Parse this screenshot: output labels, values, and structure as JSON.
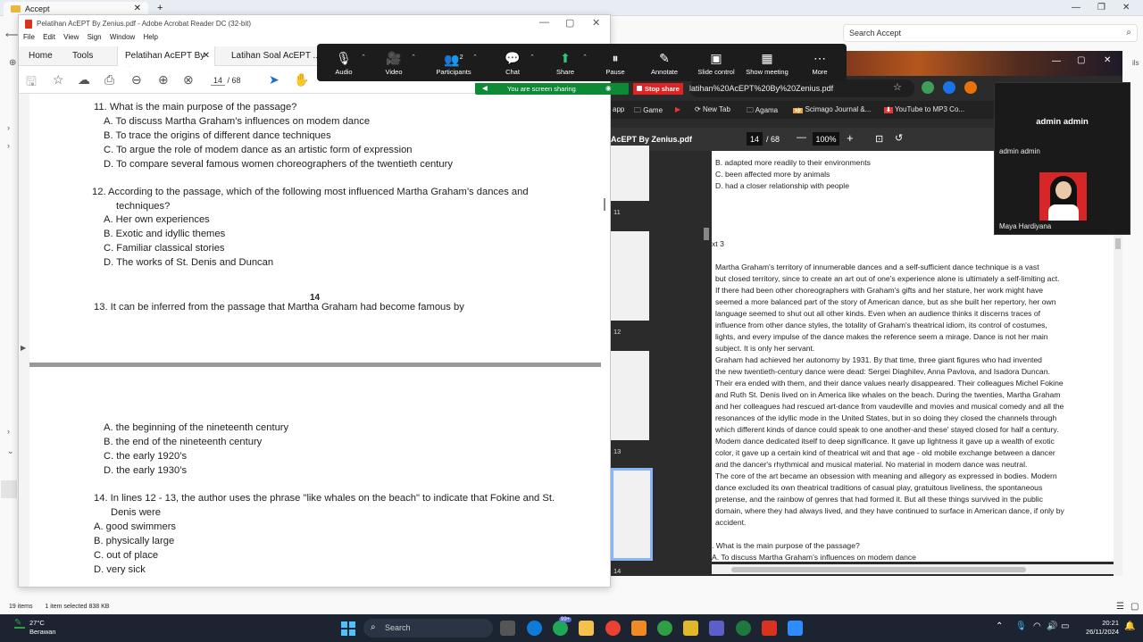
{
  "explorer": {
    "tab_title": "Accept",
    "search_placeholder": "Search Accept",
    "status_items": "19 items",
    "status_selected": "1 item selected  838 KB",
    "side_text": "ils"
  },
  "acrobat": {
    "window_title": "Pelatihan AcEPT By Zenius.pdf - Adobe Acrobat Reader DC (32-bit)",
    "menu": [
      "File",
      "Edit",
      "View",
      "Sign",
      "Window",
      "Help"
    ],
    "tabs": [
      "Home",
      "Tools",
      "Pelatihan AcEPT By ...",
      "Latihan Soal AcEPT ..."
    ],
    "page_current": "14",
    "page_total": "/ 68",
    "content": {
      "q11": "11. What is the main purpose of the passage?",
      "q11_a": "A. To discuss Martha Graham’s influences on modem dance",
      "q11_b": "B. To trace the origins of different dance techniques",
      "q11_c": "C. To argue the role of modem dance as an artistic form of expression",
      "q11_d": "D. To compare several famous women choreographers of the twentieth century",
      "q12_line1": "12.  According to the passage, which of the following most influenced Martha Graham’s dances and",
      "q12_line2": "techniques?",
      "q12_a": "A. Her own experiences",
      "q12_b": "B. Exotic and idyllic themes",
      "q12_c": "C. Familiar classical stories",
      "q12_d": "D. The works of St. Denis and Duncan",
      "page_number": "14",
      "q13": "13.  It can be inferred from the passage that Martha Graham had become famous by",
      "q13_a": "A. the beginning of the nineteenth century",
      "q13_b": "B. the end of the nineteenth century",
      "q13_c": "C. the early 1920’s",
      "q13_d": "D. the early 1930’s",
      "q14_line1": "14.  In lines 12 - 13, the author uses the phrase \"like whales on the beach\" to indicate that Fokine and St.",
      "q14_line2": "Denis were",
      "q14_a": "A.  good swimmers",
      "q14_b": "B.  physically large",
      "q14_c": "C.  out of place",
      "q14_d": "D.  very sick"
    }
  },
  "zoom": {
    "buttons": [
      "Audio",
      "Video",
      "Participants",
      "Chat",
      "Share",
      "Pause",
      "Annotate",
      "Slide control",
      "Show meeting",
      "More"
    ],
    "participants_count": "2",
    "sharing_text": "You are screen sharing",
    "stop_share": "Stop share",
    "panel_name_big": "admin admin",
    "panel_name_small": "admin admin",
    "camera_name": "Maya Hardiyana"
  },
  "chrome": {
    "address": "latihan%20AcEPT%20By%20Zenius.pdf",
    "bookmarks": [
      "app",
      "Game",
      "New Tab",
      "Agama",
      "Scimago Journal &...",
      "YouTube to MP3 Co..."
    ],
    "pdf_title": "AcEPT By Zenius.pdf",
    "pdf_page": "14",
    "pdf_total": "/ 68",
    "pdf_zoom": "100%",
    "thumb_numbers": [
      "11",
      "12",
      "13",
      "14"
    ],
    "page_lines": [
      "B. adapted more readily to their environments",
      "C. been affected more by animals",
      "D. had a closer relationship with people"
    ],
    "text_heading": "xt 3",
    "passage": [
      "        Martha Graham's territory of innumerable dances and a self-sufficient dance technique  is a vast",
      "but closed territory, since to create an art out of one's experience alone is ultimately a self-limiting act.",
      "If there had been other choreographers with Graham's gifts and her stature, her work might have",
      "seemed a more balanced part of the story of American dance, but as she built her repertory, her own",
      "language seemed to shut out all other kinds. Even when an audience thinks it discerns traces of",
      "influence from other dance styles, the totality of Graham's theatrical idiom, its control of costumes,",
      "lights, and every impulse of the dance makes the reference seem a mirage. Dance is not her main",
      "subject. It is only her servant.",
      "       Graham had achieved her autonomy by 1931. By that time, three giant figures who had invented",
      "the new twentieth-century dance were dead: Sergei Diaghilev, Anna Pavlova, and Isadora Duncan.",
      "Their era ended with them, and their dance values nearly disappeared. Their colleagues Michel Fokine",
      "and Ruth St. Denis lived on in America like whales on the beach. During the twenties, Martha Graham",
      "and her colleagues had rescued art-dance from vaudeville and movies and musical comedy and all the",
      "resonances of the idyllic mode in the United States, but in so doing they closed the channels through",
      "which different kinds of dance could speak to one another-and these' stayed closed for half a century.",
      "Modem dance dedicated itself to deep significance. It gave up lightness it gave up a wealth of exotic",
      "color, it gave up a certain kind of theatrical wit and that age - old mobile exchange between a dancer",
      "and the dancer's rhythmical and musical material. No material in modem dance was neutral.",
      "The core of the art became an obsession with meaning and allegory as expressed in bodies. Modern",
      "dance excluded its own theatrical traditions of casual play, gratuitous liveliness, the spontaneous",
      "pretense, and the rainbow of genres that had formed it. But all these things survived in the public",
      "domain, where they had always lived, and they have continued to surface in American dance, if only by",
      "accident."
    ],
    "page_q": ". What is the main purpose of the passage?",
    "page_q_a": "A. To discuss Martha Graham’s influences on modem dance"
  },
  "taskbar": {
    "temperature": "27°C",
    "weather": "Berawan",
    "search": "Search",
    "badge": "99+",
    "time": "20:21",
    "date": "26/11/2024"
  }
}
